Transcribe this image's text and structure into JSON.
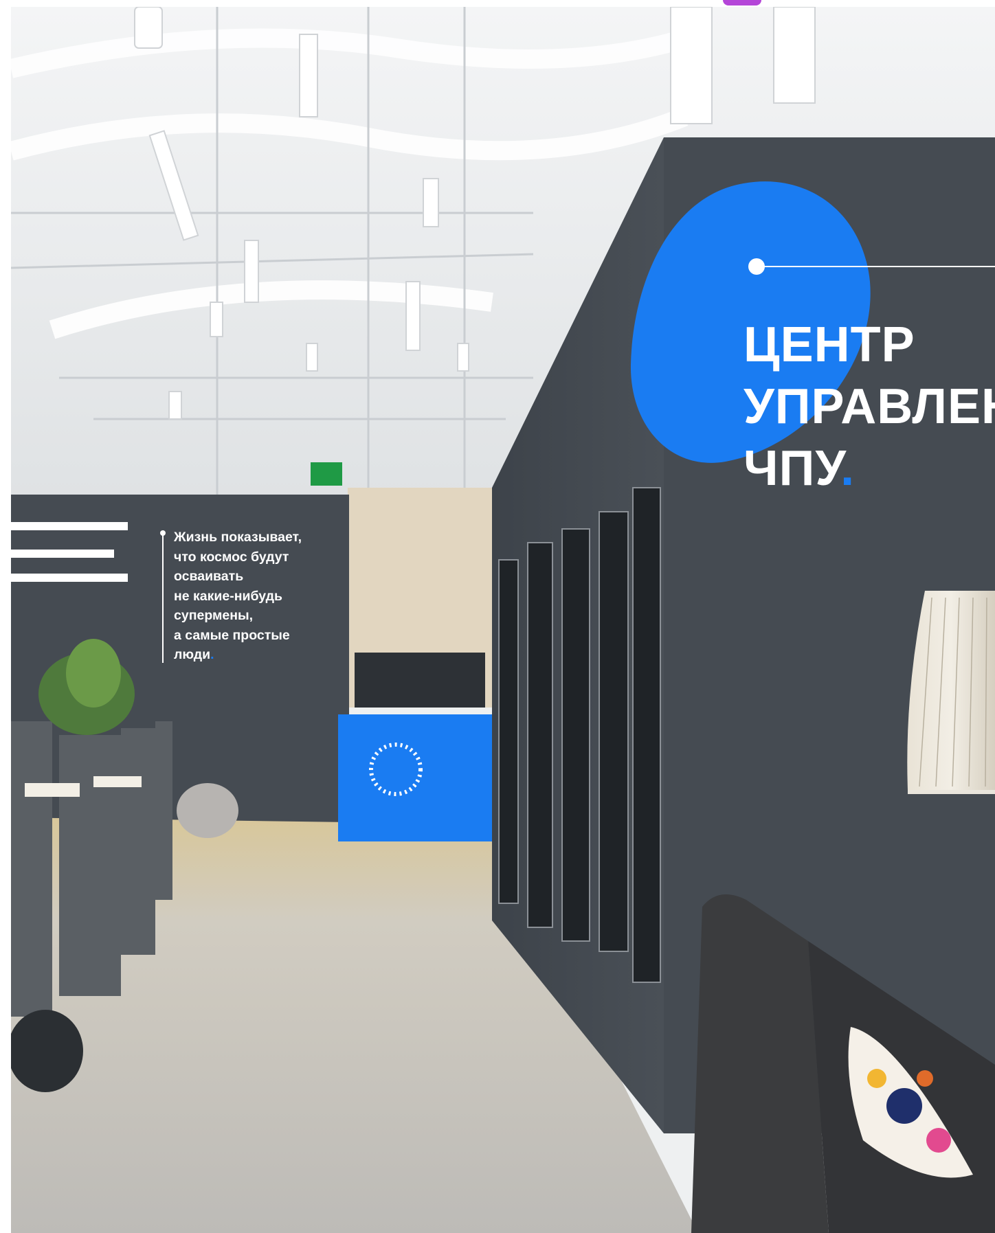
{
  "wall_quote": {
    "lines": [
      "Жизнь показывает,",
      "что космос будут",
      "осваивать",
      "не какие-нибудь",
      "супермены,",
      "а самые простые",
      "люди"
    ],
    "end_dot": "."
  },
  "wall_title": {
    "lines": [
      "ЦЕНТР",
      "УПРАВЛЕН",
      "ЧПУ"
    ],
    "end_dot": "."
  },
  "colors": {
    "accent_blue": "#1a7cf2",
    "wall_dark": "#454b52",
    "ceiling": "#eef0f1",
    "floor": "#c9c7c3",
    "badge": "#b445d8"
  }
}
